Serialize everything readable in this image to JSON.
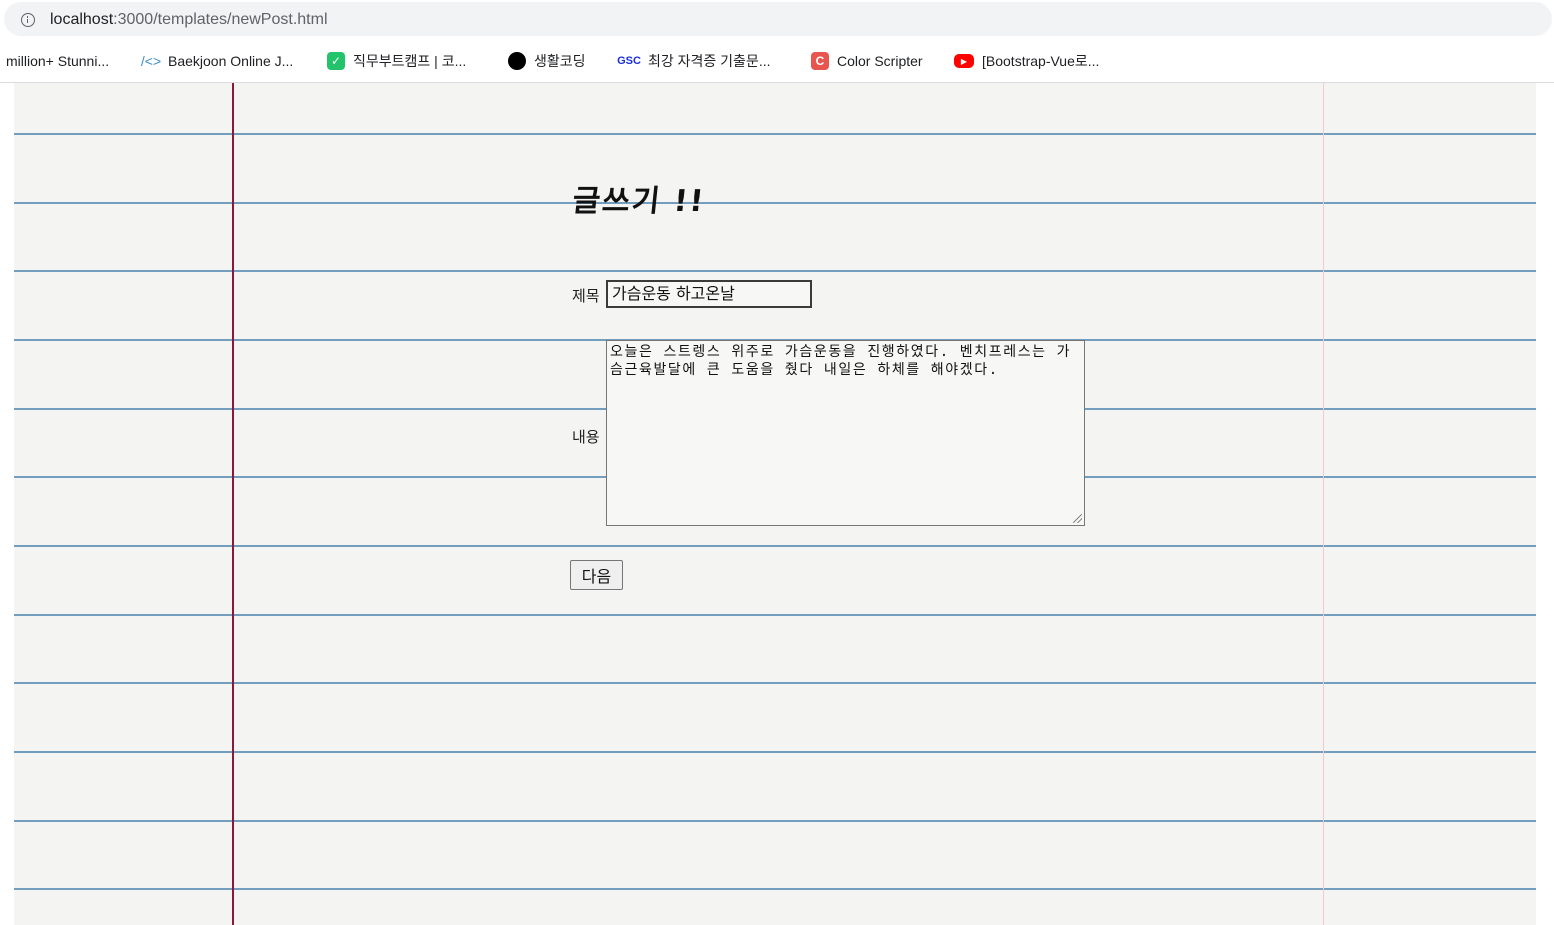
{
  "browser": {
    "url_host": "localhost",
    "url_path": ":3000/templates/newPost.html",
    "bookmarks": [
      {
        "label": "million+ Stunni...",
        "icon": "none"
      },
      {
        "label": "Baekjoon Online J...",
        "icon": "code-brackets-icon"
      },
      {
        "label": "직무부트캠프 | 코...",
        "icon": "green-leaf-icon"
      },
      {
        "label": "생활코딩",
        "icon": "black-circle-icon"
      },
      {
        "label": "최강 자격증 기출문...",
        "icon": "gsc-logo-icon"
      },
      {
        "label": "Color Scripter",
        "icon": "color-scripter-icon"
      },
      {
        "label": "[Bootstrap-Vue로...",
        "icon": "youtube-icon"
      }
    ]
  },
  "form": {
    "title": "글쓰기 !!",
    "title_label": "제목",
    "title_value": "가슴운동 하고온날",
    "content_label": "내용",
    "content_value": "오늘은 스트렝스 위주로 가슴운동을 진행하였다. 벤치프레스는 가슴근육발달에 큰 도움을 줬다 내일은 하체를 해야겠다.",
    "submit_label": "다음"
  }
}
